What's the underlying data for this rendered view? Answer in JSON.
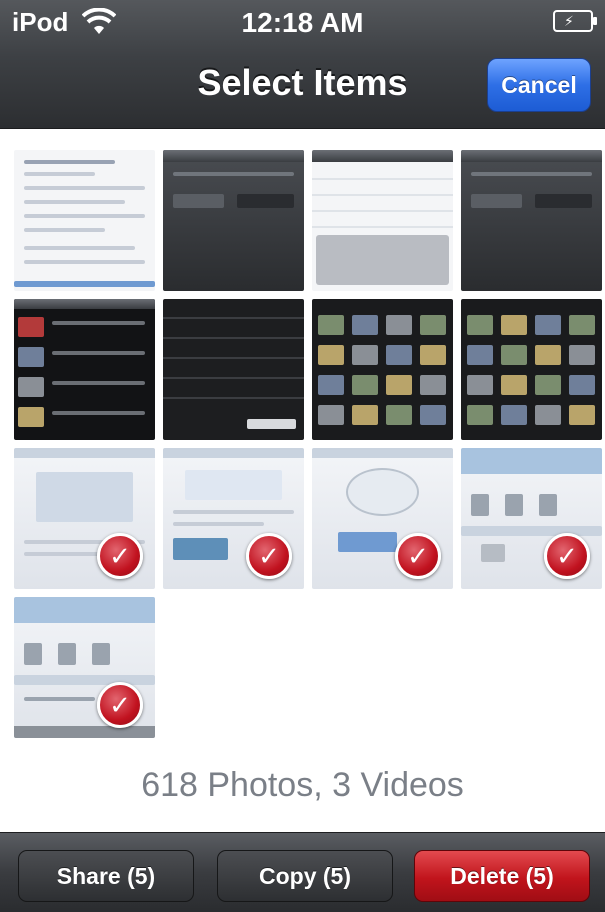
{
  "status_bar": {
    "carrier": "iPod",
    "time": "12:18 AM"
  },
  "nav": {
    "title": "Select Items",
    "cancel_label": "Cancel"
  },
  "grid": {
    "thumbnails": [
      {
        "id": 1,
        "style": "paper",
        "selected": false
      },
      {
        "id": 2,
        "style": "dark",
        "selected": false
      },
      {
        "id": 3,
        "style": "dark-keyboard",
        "selected": false
      },
      {
        "id": 4,
        "style": "dark",
        "selected": false
      },
      {
        "id": 5,
        "style": "dark-list",
        "selected": false
      },
      {
        "id": 6,
        "style": "dark-menu",
        "selected": false
      },
      {
        "id": 7,
        "style": "dark-photos",
        "selected": false
      },
      {
        "id": 8,
        "style": "dark-photos",
        "selected": false
      },
      {
        "id": 9,
        "style": "light",
        "selected": true
      },
      {
        "id": 10,
        "style": "light",
        "selected": true
      },
      {
        "id": 11,
        "style": "light",
        "selected": true
      },
      {
        "id": 12,
        "style": "light",
        "selected": true
      },
      {
        "id": 13,
        "style": "light",
        "selected": true
      }
    ]
  },
  "library": {
    "counts_label": "618 Photos, 3 Videos"
  },
  "toolbar": {
    "share_label": "Share (5)",
    "copy_label": "Copy (5)",
    "delete_label": "Delete (5)"
  },
  "colors": {
    "accent_blue": "#2e6fe6",
    "destructive_red": "#c1141c",
    "check_red": "#c1121f"
  },
  "icons": {
    "checkmark": "✓",
    "wifi": "wifi-icon",
    "battery": "battery-charging-icon"
  }
}
